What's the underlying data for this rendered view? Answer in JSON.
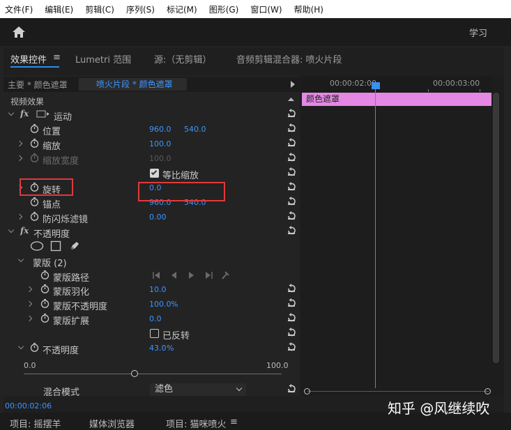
{
  "menu": [
    "文件(F)",
    "编辑(E)",
    "剪辑(C)",
    "序列(S)",
    "标记(M)",
    "图形(G)",
    "窗口(W)",
    "帮助(H)"
  ],
  "header": {
    "learn": "学习"
  },
  "tabs": {
    "effect_controls": "效果控件",
    "menu_glyph": "≡",
    "lumetri": "Lumetri 范围",
    "source": "源:（无剪辑）",
    "audio_mixer": "音频剪辑混合器: 喷火片段"
  },
  "clipbar": {
    "master": "主要 * 颜色遮罩",
    "clip": "喷火片段 * 颜色遮罩"
  },
  "effects": {
    "video_effects": "视频效果",
    "motion": "运动",
    "position": {
      "label": "位置",
      "x": "960.0",
      "y": "540.0"
    },
    "scale": {
      "label": "缩放",
      "value": "100.0"
    },
    "scale_width": {
      "label": "缩放宽度",
      "value": "100.0"
    },
    "uniform_scale": "等比缩放",
    "rotation": {
      "label": "旋转",
      "value": "0.0"
    },
    "anchor": {
      "label": "锚点",
      "x": "960.0",
      "y": "540.0"
    },
    "anti_flicker": {
      "label": "防闪烁滤镜",
      "value": "0.00"
    },
    "opacity_group": "不透明度",
    "mask": "蒙版 (2)",
    "mask_path": "蒙版路径",
    "mask_feather": {
      "label": "蒙版羽化",
      "value": "10.0"
    },
    "mask_opacity": {
      "label": "蒙版不透明度",
      "value": "100.0",
      "unit": "%"
    },
    "mask_expansion": {
      "label": "蒙版扩展",
      "value": "0.0"
    },
    "inverted": "已反转",
    "opacity": {
      "label": "不透明度",
      "value": "43.0",
      "unit": "%"
    },
    "slider_min": "0.0",
    "slider_max": "100.0",
    "slider_value": 43,
    "blend_mode": {
      "label": "混合模式",
      "value": "滤色"
    }
  },
  "timeline": {
    "tc1": "00:00:02:00",
    "tc2": "00:00:03:00",
    "clip_label": "颜色遮罩"
  },
  "current_time": "00:00:02:06",
  "bottom_tabs": {
    "project1": "项目: 摇摆羊",
    "media": "媒体浏览器",
    "project2": "项目: 猫咪喷火",
    "menu_glyph": "≡"
  },
  "watermark": "知乎 @风继续吹",
  "colors": {
    "accent": "#3d96ff",
    "clip": "#e488e4",
    "highlight": "#e03a3a"
  }
}
